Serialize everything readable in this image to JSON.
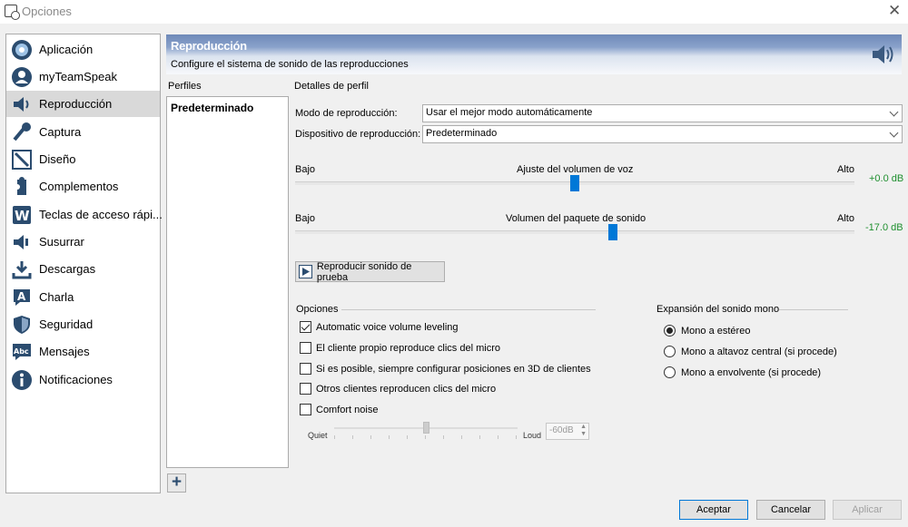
{
  "window": {
    "title": "Opciones",
    "close_glyph": "✕"
  },
  "sidebar": {
    "items": [
      {
        "label": "Aplicación",
        "icon": "application-icon"
      },
      {
        "label": "myTeamSpeak",
        "icon": "user-icon"
      },
      {
        "label": "Reproducción",
        "icon": "speaker-icon",
        "active": true
      },
      {
        "label": "Captura",
        "icon": "microphone-icon"
      },
      {
        "label": "Diseño",
        "icon": "design-icon"
      },
      {
        "label": "Complementos",
        "icon": "puzzle-icon"
      },
      {
        "label": "Teclas de acceso rápi...",
        "icon": "hotkeys-icon"
      },
      {
        "label": "Susurrar",
        "icon": "whisper-icon"
      },
      {
        "label": "Descargas",
        "icon": "download-icon"
      },
      {
        "label": "Charla",
        "icon": "chat-icon"
      },
      {
        "label": "Seguridad",
        "icon": "shield-icon"
      },
      {
        "label": "Mensajes",
        "icon": "messages-icon"
      },
      {
        "label": "Notificaciones",
        "icon": "notifications-icon"
      }
    ]
  },
  "header": {
    "title": "Reproducción",
    "subtitle": "Configure el sistema de sonido de las reproducciones"
  },
  "profiles": {
    "label": "Perfiles",
    "items": [
      "Predeterminado"
    ],
    "add_glyph": "+"
  },
  "details": {
    "label": "Detalles de perfil",
    "mode": {
      "label": "Modo de reproducción:",
      "value": "Usar el mejor modo automáticamente"
    },
    "device": {
      "label": "Dispositivo de reproducción:",
      "value": "Predeterminado"
    },
    "voice_volume": {
      "low": "Bajo",
      "title": "Ajuste del volumen de voz",
      "high": "Alto",
      "value": "+0.0 dB",
      "position": 0.5
    },
    "sound_pack_volume": {
      "low": "Bajo",
      "title": "Volumen del paquete de sonido",
      "high": "Alto",
      "value": "-17.0 dB",
      "position": 0.57
    },
    "test_button": "Reproducir sonido de prueba"
  },
  "options": {
    "label": "Opciones",
    "items": [
      {
        "label": "Automatic voice volume leveling",
        "checked": true
      },
      {
        "label": "El cliente propio reproduce clics del micro",
        "checked": false
      },
      {
        "label": "Si es posible, siempre configurar posiciones en 3D de clientes",
        "checked": false
      },
      {
        "label": "Otros clientes reproducen clics del micro",
        "checked": false
      },
      {
        "label": "Comfort noise",
        "checked": false
      }
    ],
    "noise": {
      "quiet": "Quiet",
      "loud": "Loud",
      "value": "-60dB",
      "position": 0.5
    }
  },
  "mono": {
    "label": "Expansión del sonido mono",
    "items": [
      {
        "label": "Mono a estéreo",
        "checked": true
      },
      {
        "label": "Mono a altavoz central (si procede)",
        "checked": false
      },
      {
        "label": "Mono a envolvente (si procede)",
        "checked": false
      }
    ]
  },
  "footer": {
    "accept": "Aceptar",
    "cancel": "Cancelar",
    "apply": "Aplicar"
  }
}
